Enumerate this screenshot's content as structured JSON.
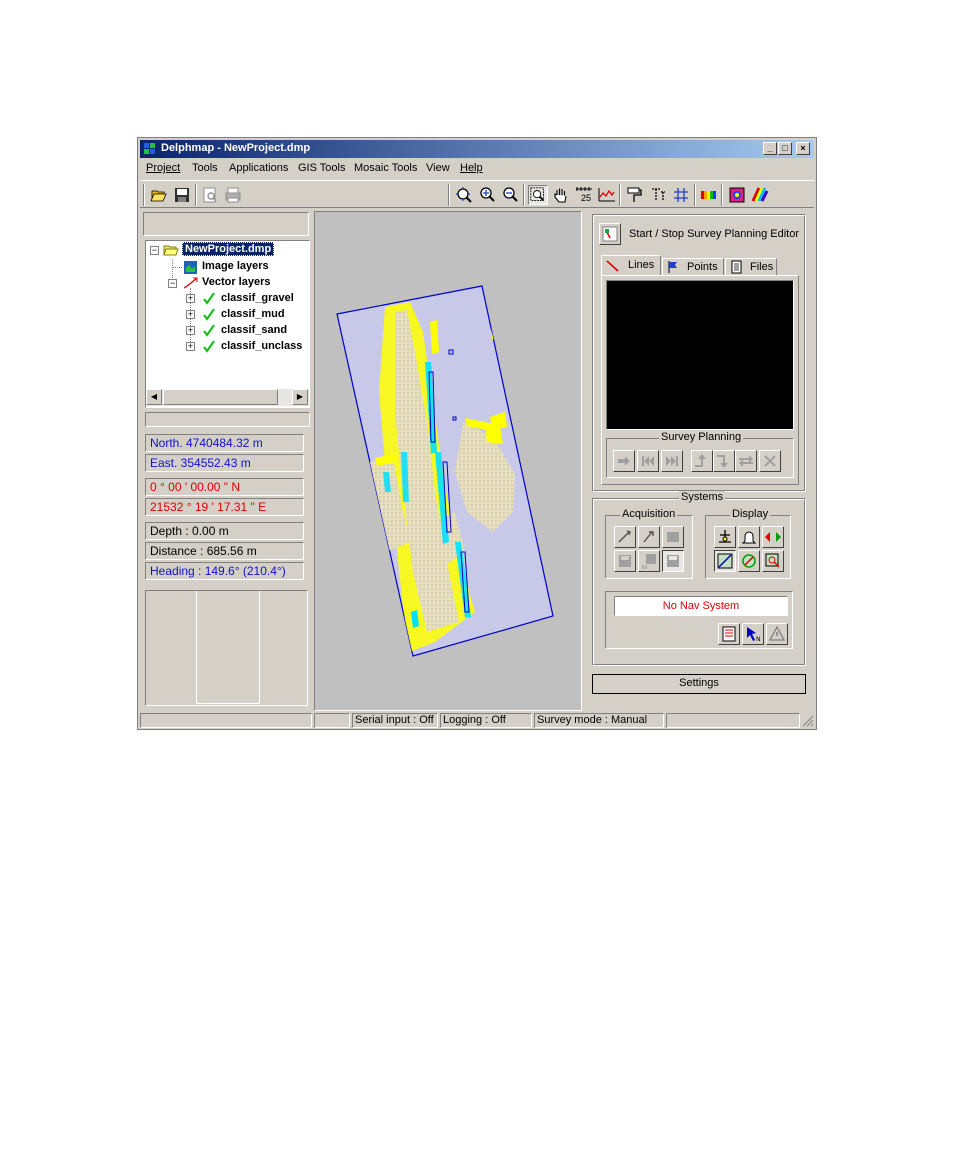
{
  "window": {
    "title": "Delphmap - NewProject.dmp",
    "controls": [
      "_",
      "□",
      "×"
    ]
  },
  "menu": {
    "project": "Project",
    "tools": "Tools",
    "applications": "Applications",
    "gis_tools": "GIS Tools",
    "mosaic_tools": "Mosaic Tools",
    "view": "View",
    "help": "Help"
  },
  "toolbar": {
    "scale_label": "25"
  },
  "tree": {
    "root": "NewProject.dmp",
    "image_layers": "Image layers",
    "vector_layers": "Vector layers",
    "layers": [
      "classif_gravel",
      "classif_mud",
      "classif_sand",
      "classif_unclass"
    ]
  },
  "position": {
    "north": "North. 4740484.32 m",
    "east": "East.  354552.43 m",
    "lat": " 0 ° 00 ' 00.00 \" N",
    "lon": "21532 ° 19 ' 17.31 \" E",
    "depth": "Depth : 0.00 m",
    "distance": "Distance : 685.56 m",
    "heading": "Heading : 149.6° (210.4°)"
  },
  "survey": {
    "editor_label": "Start / Stop Survey Planning Editor",
    "tabs": [
      "Lines",
      "Points",
      "Files"
    ],
    "group_label": "Survey Planning"
  },
  "systems": {
    "group_label": "Systems",
    "acquisition_label": "Acquisition",
    "display_label": "Display",
    "nav_status": "No Nav System",
    "settings_label": "Settings"
  },
  "status": {
    "serial": "Serial input : Off",
    "logging": "Logging : Off",
    "survey_mode": "Survey mode : Manual"
  },
  "colors": {
    "title_start": "#0a246a",
    "title_end": "#a6caf0",
    "survey_area": "#c8c8e8",
    "boundary": "#0000c8",
    "sand": "#ffff00",
    "gravel": "#00ffff",
    "mud": "#e8e0c8",
    "coord_blue": "#1010d0",
    "coord_red": "#e00000"
  }
}
